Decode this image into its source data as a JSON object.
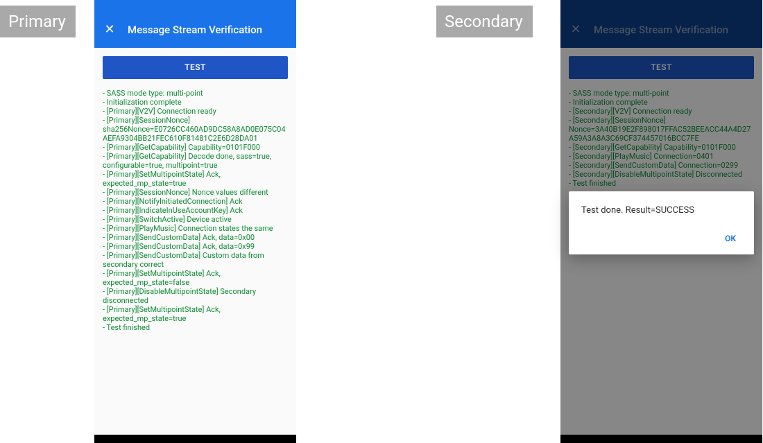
{
  "tags": {
    "primary": "Primary",
    "secondary": "Secondary"
  },
  "appbar": {
    "title": "Message Stream Verification"
  },
  "buttons": {
    "test": "TEST"
  },
  "dialog": {
    "message": "Test done. Result=SUCCESS",
    "ok": "OK"
  },
  "primary_log": [
    " - SASS mode type: multi-point",
    " - Initialization complete",
    " - [Primary][V2V] Connection ready",
    " - [Primary][SessionNonce] sha256Nonce=E0726CC460AD9DC58A8AD0E075C04AEFA9304BB21FEC610F81481C2E6D28DA01",
    " - [Primary][GetCapability] Capability=0101F000",
    " - [Primary][GetCapability] Decode done, sass=true, configurable=true, multipoint=true",
    " - [Primary][SetMultipointState] Ack, expected_mp_state=true",
    " - [Primary][SessionNonce] Nonce values different",
    " - [Primary][NotifyInitiatedConnection] Ack",
    " - [Primary][IndicateInUseAccountKey] Ack",
    " - [Primary][SwitchActive] Device active",
    " - [Primary][PlayMusic] Connection states the same",
    " - [Primary][SendCustomData] Ack, data=0x00",
    " - [Primary][SendCustomData] Ack, data=0x99",
    " - [Primary][SendCustomData] Custom data from secondary correct",
    " - [Primary][SetMultipointState] Ack, expected_mp_state=false",
    " - [Primary][DisableMultipointState] Secondary disconnected",
    " - [Primary][SetMultipointState] Ack, expected_mp_state=true",
    " - Test finished"
  ],
  "secondary_log": [
    " - SASS mode type: multi-point",
    " - Initialization complete",
    " - [Secondary][V2V] Connection ready",
    " - [Secondary][SessionNonce] Nonce=3A40B19E2F898017FFAC52BEEACC44A4D27A59A3A8A3C69CF374457016BCC7FE",
    " - [Secondary][GetCapability] Capability=0101F000",
    " - [Secondary][PlayMusic] Connection=0401",
    " - [Secondary][SendCustomData] Connection=0299",
    " - [Secondary][DisableMultipointState] Disconnected",
    " - Test finished"
  ]
}
